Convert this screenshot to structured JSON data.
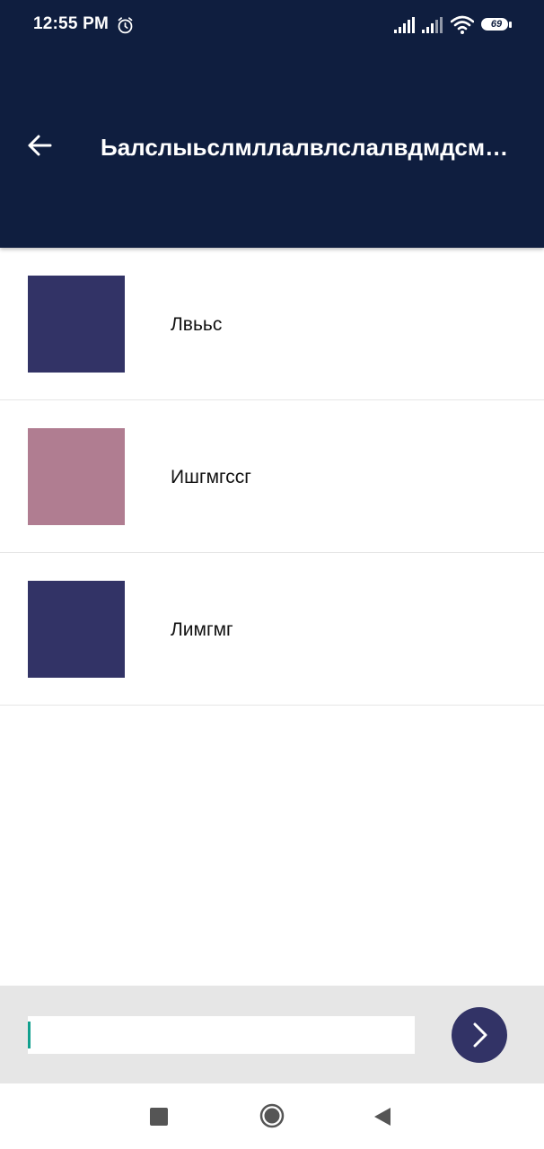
{
  "status_bar": {
    "time": "12:55 PM",
    "battery_level": "69",
    "icons": [
      "alarm-icon",
      "signal-icon",
      "signal-icon",
      "wifi-icon",
      "battery-icon"
    ]
  },
  "toolbar": {
    "title": "Ьалслыьслмллалвлслалвдмдсмщмс",
    "back_icon": "arrow-left-icon",
    "background_color": "#0f1e3f"
  },
  "list": {
    "items": [
      {
        "label": "Лвььс",
        "color": "#323366"
      },
      {
        "label": "Ишгмгссг",
        "color": "#b07d91"
      },
      {
        "label": "Лимгмг",
        "color": "#323366"
      }
    ]
  },
  "input": {
    "value": "",
    "placeholder": "",
    "send_icon": "chevron-right-icon",
    "send_color": "#323366"
  },
  "nav_bar": {
    "icons": [
      "square-recents-icon",
      "circle-home-icon",
      "triangle-back-icon"
    ]
  }
}
